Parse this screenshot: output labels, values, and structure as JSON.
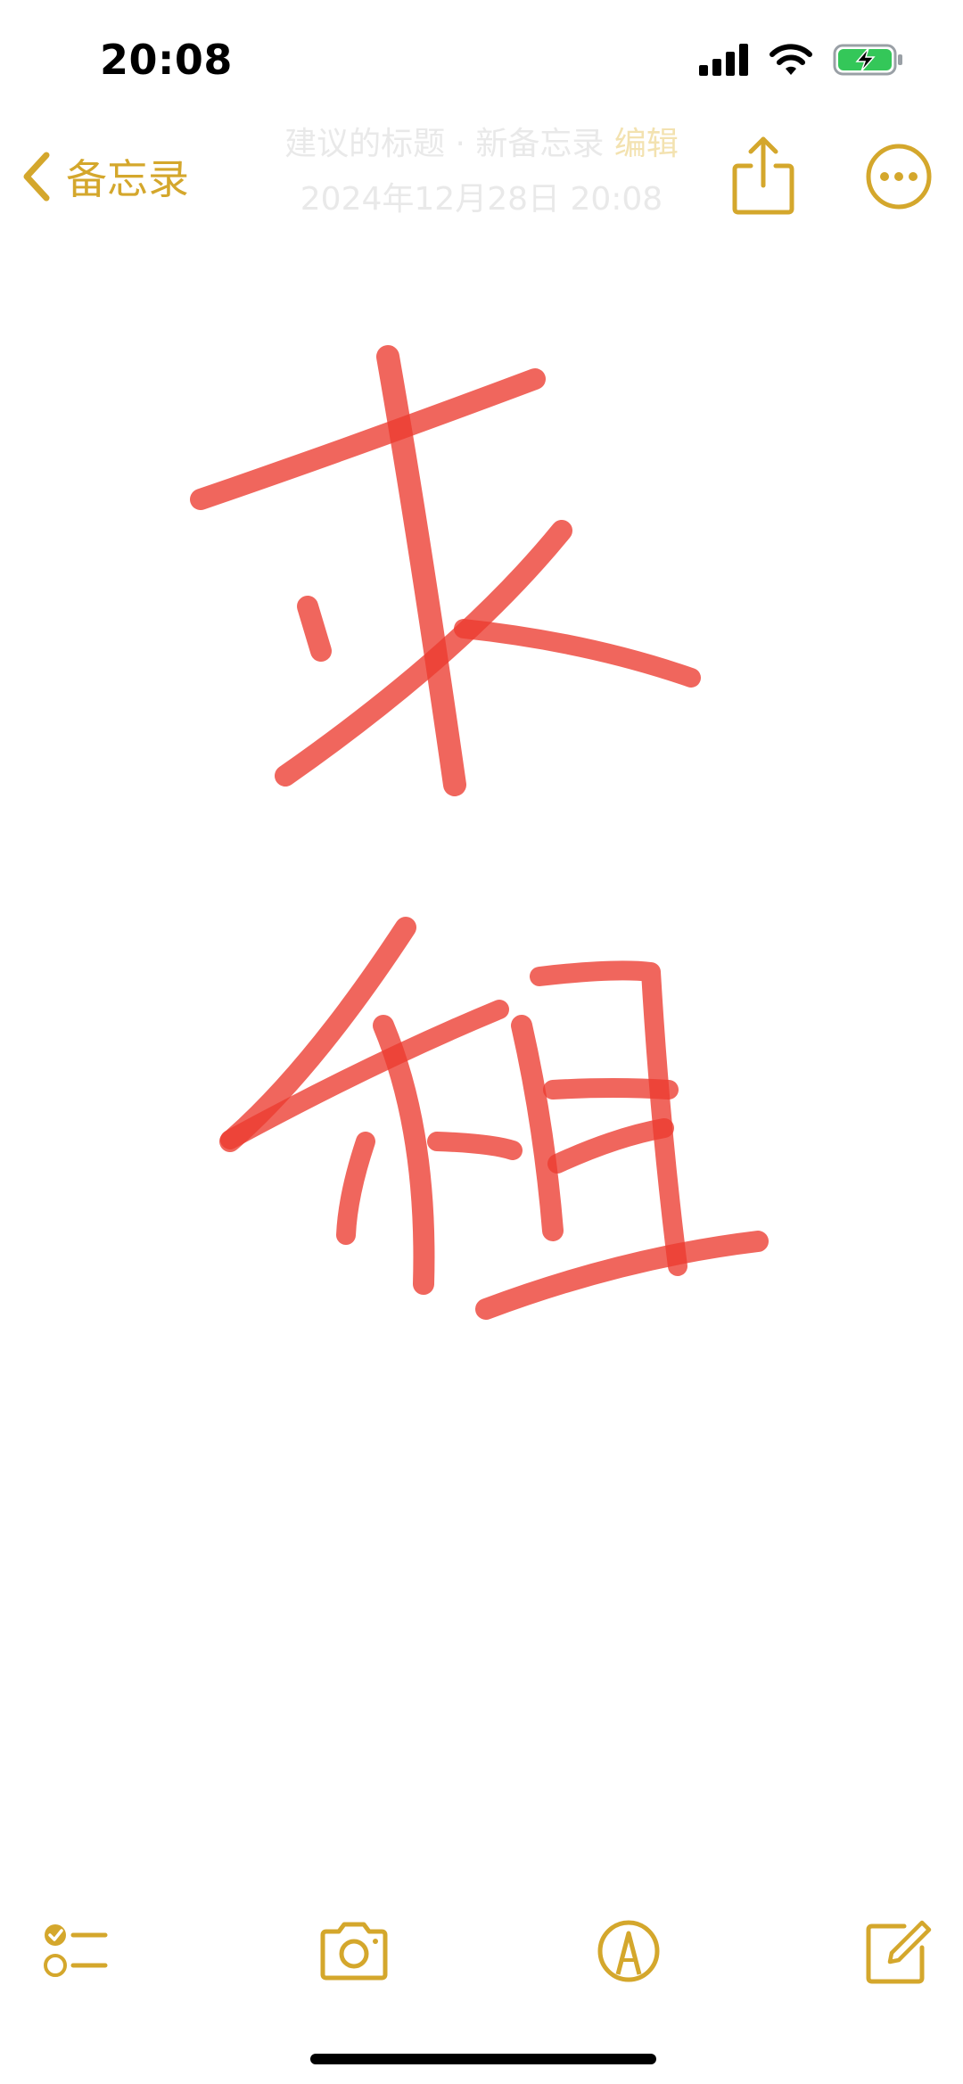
{
  "status_bar": {
    "time": "20:08",
    "signal_icon": "cellular-signal-icon",
    "wifi_icon": "wifi-icon",
    "battery_icon": "battery-charging-icon",
    "battery_color": "#34c759"
  },
  "nav": {
    "back_label": "备忘录",
    "back_icon": "chevron-left-icon",
    "faded_title": "建议的标题 · 新备忘录",
    "faded_badge": "编辑",
    "faded_date": "2024年12月28日 20:08",
    "share_icon": "share-icon",
    "more_icon": "ellipsis-circle-icon"
  },
  "drawing": {
    "description_chars": [
      "求",
      "租"
    ],
    "stroke_color": "#ec3b30"
  },
  "toolbar": {
    "checklist_icon": "checklist-icon",
    "camera_icon": "camera-icon",
    "markup_icon": "markup-pen-icon",
    "compose_icon": "compose-icon"
  },
  "theme": {
    "accent": "#d4a72c"
  }
}
